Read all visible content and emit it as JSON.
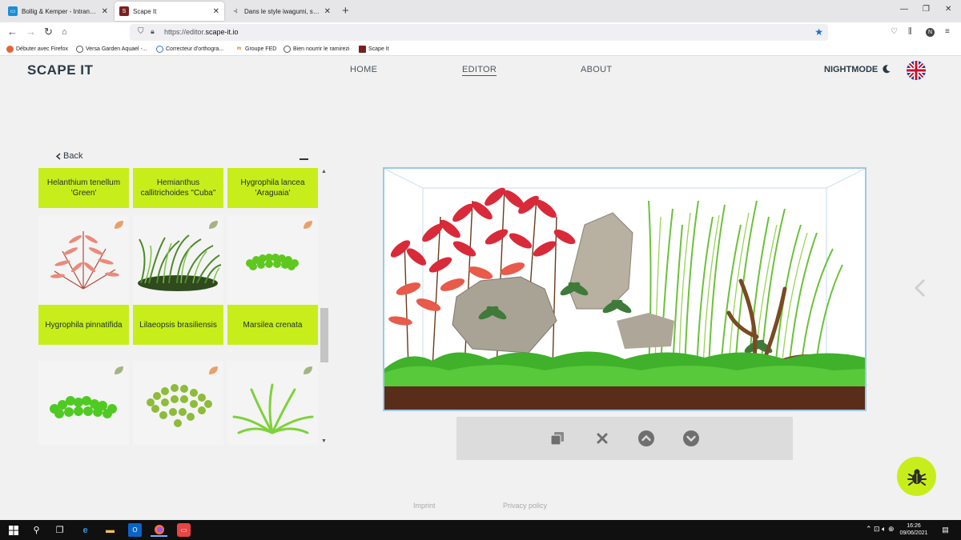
{
  "browser": {
    "tabs": [
      {
        "title": "Bollig & Kemper - Intranet : Con",
        "active": false
      },
      {
        "title": "Scape It",
        "active": true
      },
      {
        "title": "Dans le style iwagumi, sur le for",
        "active": false
      }
    ],
    "url_prefix": "https://editor.",
    "url_domain": "scape-it.io",
    "bookmarks": [
      "Débuter avec Firefox",
      "Versa Garden Aquael -...",
      "Correcteur d'orthogra...",
      "Groupe FED",
      "Bien nourrir le ramirezi",
      "Scape It"
    ]
  },
  "site": {
    "logo": "SCAPE IT",
    "nav": [
      "HOME",
      "EDITOR",
      "ABOUT"
    ],
    "active_nav": "EDITOR",
    "nightmode_label": "NIGHTMODE",
    "language": "English (UK flag)"
  },
  "panel": {
    "back_label": "Back",
    "rows": [
      {
        "labels": [
          "Helanthium tenellum 'Green'",
          "Hemianthus callitrichoides \"Cuba\"",
          "Hygrophila lancea 'Araguaia'"
        ]
      },
      {
        "labels": [
          "Hygrophila pinnatifida",
          "Lilaeopsis brasiliensis",
          "Marsilea crenata"
        ]
      }
    ],
    "leaf_badge_colors": {
      "orange": "#e8a06a",
      "green": "#a4b384"
    }
  },
  "toolbar": {
    "buttons": [
      "copy-icon",
      "delete-icon",
      "move-up-icon",
      "move-down-icon"
    ]
  },
  "footer": {
    "imprint": "Imprint",
    "privacy": "Privacy policy"
  },
  "taskbar": {
    "time": "16:26",
    "date": "09/06/2021"
  },
  "colors": {
    "accent_lime": "#c7ee1a",
    "text_dark": "#2c3947",
    "tank_border": "#9bc9e7"
  }
}
